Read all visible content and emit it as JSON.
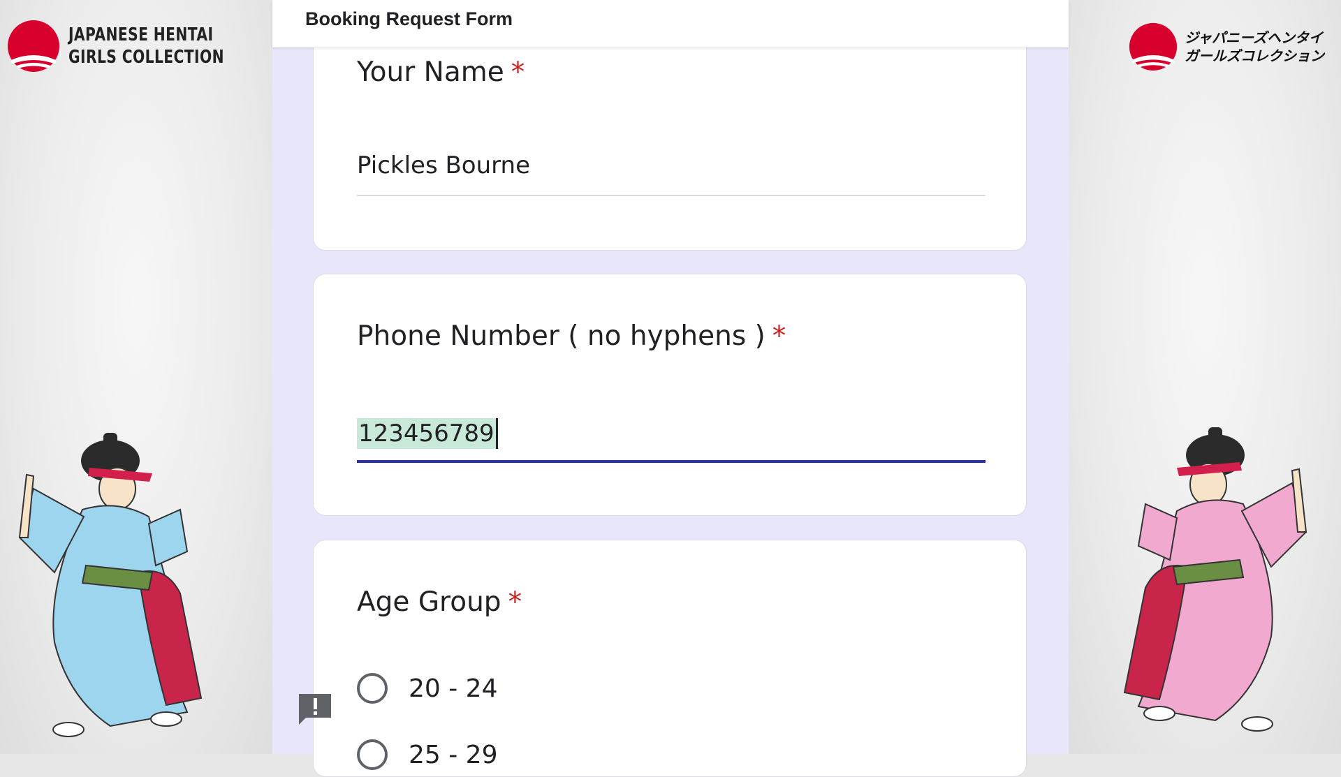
{
  "branding": {
    "left_line1": "JAPANESE HENTAI",
    "left_line2": "GIRLS COLLECTION",
    "right_line1": "ジャパニーズヘンタイ",
    "right_line2": "ガールズコレクション",
    "brand_red": "#d8002c"
  },
  "form": {
    "header_title": "Booking Request Form",
    "required_marker": "*",
    "questions": [
      {
        "title": "Your Name",
        "value": "Pickles Bourne"
      },
      {
        "title": "Phone Number ( no hyphens )",
        "value": "123456789"
      },
      {
        "title": "Age Group",
        "options": [
          "20 - 24",
          "25 - 29"
        ]
      }
    ],
    "accent_color": "#2b2fa6",
    "background_color": "#e7e6fb"
  },
  "icons": {
    "feedback": "report-feedback-icon"
  }
}
